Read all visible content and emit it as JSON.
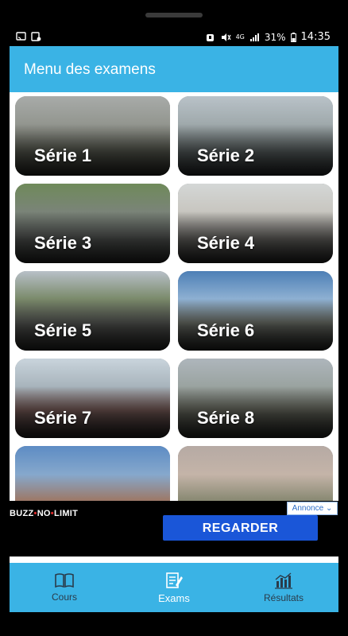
{
  "status_bar": {
    "battery_percent": "31%",
    "time": "14:35",
    "network": "4G"
  },
  "appbar": {
    "title": "Menu des examens"
  },
  "series": [
    {
      "label": "Série 1"
    },
    {
      "label": "Série 2"
    },
    {
      "label": "Série 3"
    },
    {
      "label": "Série 4"
    },
    {
      "label": "Série 5"
    },
    {
      "label": "Série 6"
    },
    {
      "label": "Série 7"
    },
    {
      "label": "Série 8"
    },
    {
      "label": ""
    },
    {
      "label": ""
    }
  ],
  "ad": {
    "brand_part1": "BUZZ",
    "brand_part2": "NO",
    "brand_part3": "LIMIT",
    "annonce": "Annonce",
    "cta": "REGARDER"
  },
  "bottom_nav": [
    {
      "label": "Cours",
      "icon": "book-icon"
    },
    {
      "label": "Exams",
      "icon": "exam-edit-icon"
    },
    {
      "label": "Résultats",
      "icon": "bar-chart-icon"
    }
  ],
  "colors": {
    "accent": "#3ab3e5",
    "ad_button": "#1a56d8"
  }
}
